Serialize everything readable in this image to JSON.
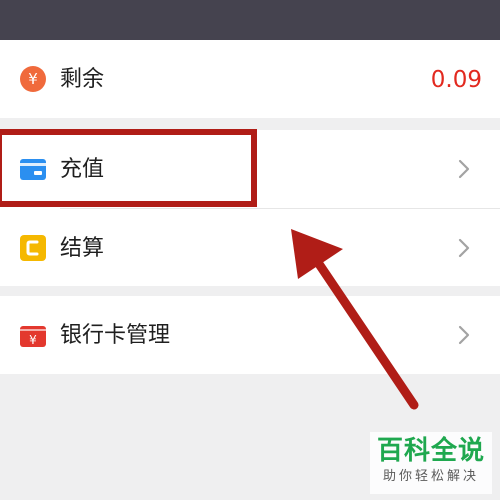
{
  "balance_row": {
    "label": "剩余",
    "value": "0.09",
    "icon": "yen-coin-icon"
  },
  "menu": [
    {
      "label": "充值",
      "icon": "card-icon"
    },
    {
      "label": "结算",
      "icon": "settle-icon"
    }
  ],
  "bank_row": {
    "label": "银行卡管理",
    "icon": "bank-card-yen-icon"
  },
  "watermark": {
    "main": "百科全说",
    "sub": "助你轻松解决"
  },
  "colors": {
    "accent_red": "#e2291f",
    "top_bar": "#45434f",
    "highlight": "#b01d17",
    "watermark_green": "#1fa84f"
  }
}
